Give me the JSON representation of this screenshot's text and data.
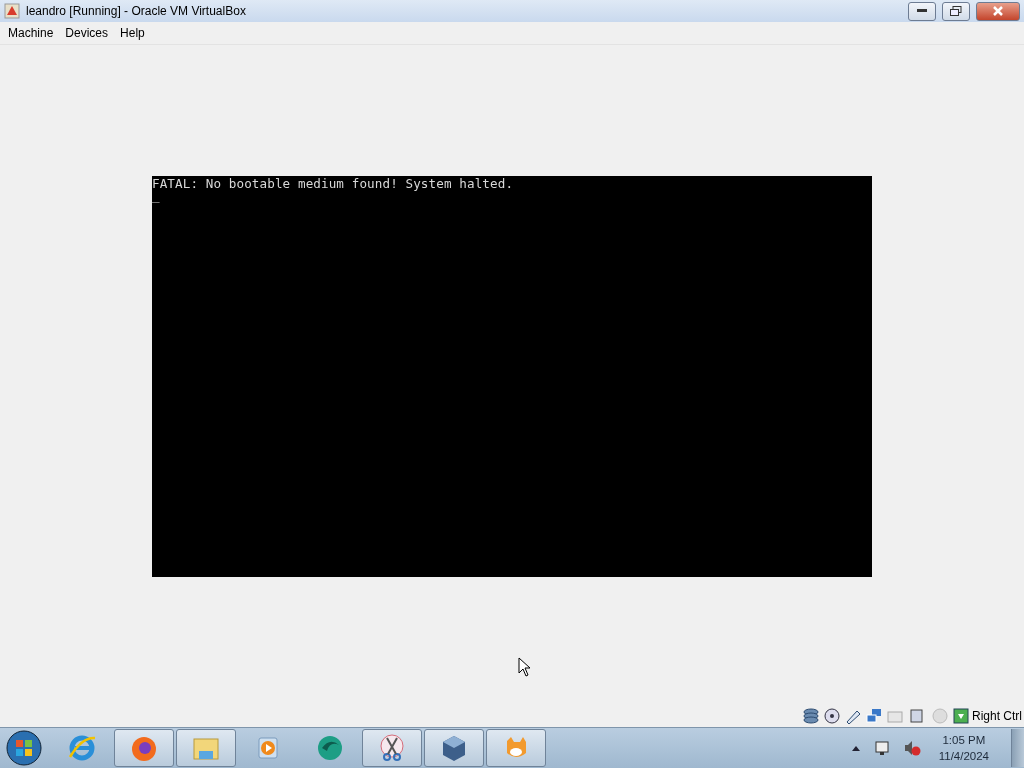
{
  "window": {
    "title": "leandro [Running] - Oracle VM VirtualBox"
  },
  "menu": [
    "Machine",
    "Devices",
    "Help"
  ],
  "console": {
    "lines": [
      "FATAL: No bootable medium found! System halted."
    ],
    "cursor": "_"
  },
  "status_bar": {
    "host_key": "Right Ctrl"
  },
  "taskbar": {
    "items": [
      {
        "kind": "ie",
        "running": false
      },
      {
        "kind": "firefox",
        "running": true
      },
      {
        "kind": "explorer",
        "running": true
      },
      {
        "kind": "media",
        "running": false
      },
      {
        "kind": "globe",
        "running": false
      },
      {
        "kind": "scissors",
        "running": true
      },
      {
        "kind": "cube",
        "running": true
      },
      {
        "kind": "cat",
        "running": true
      }
    ],
    "clock": {
      "time": "1:05 PM",
      "date": "11/4/2024"
    }
  }
}
